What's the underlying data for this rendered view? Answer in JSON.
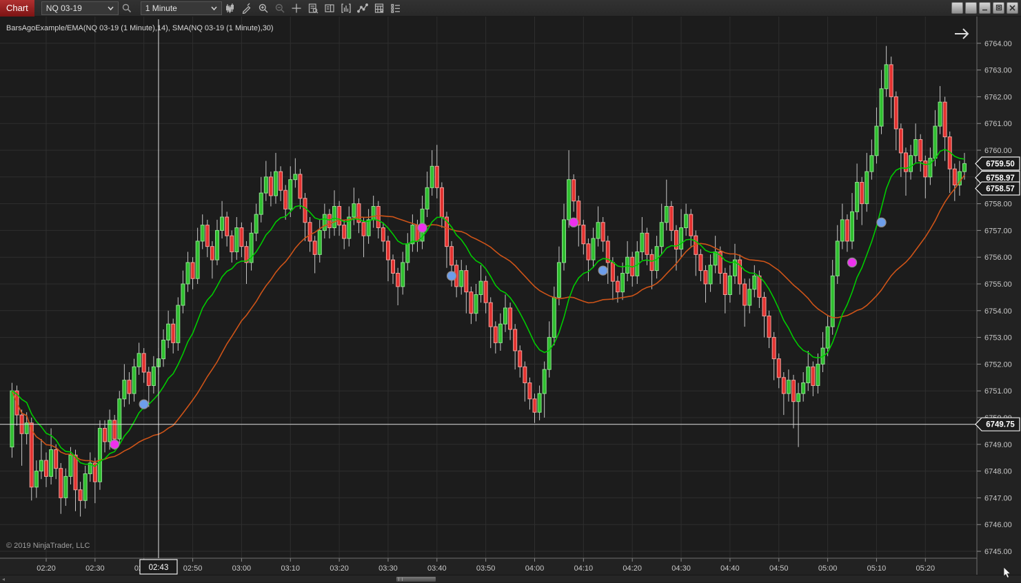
{
  "toolbar": {
    "tab_label": "Chart",
    "instrument": "NQ 03-19",
    "interval": "1 Minute",
    "icons": [
      "search-icon",
      "chart-style-icon",
      "drawing-tools-icon",
      "zoom-in-icon",
      "zoom-out-icon",
      "crosshair-icon",
      "data-box-icon",
      "chart-trader-icon",
      "indicators-icon",
      "line-tools-icon",
      "strategies-icon",
      "properties-icon"
    ]
  },
  "window": {
    "control_icons": [
      "instrument-link-icon",
      "interval-link-icon",
      "minimize-icon",
      "restore-icon",
      "close-icon"
    ]
  },
  "chart": {
    "title": "BarsAgoExample/EMA(NQ 03-19 (1 Minute),14), SMA(NQ 03-19 (1 Minute),30)",
    "copyright": "© 2019 NinjaTrader, LLC",
    "colors": {
      "plot_bg": "#1c1c1c",
      "axis_bg": "#222222",
      "grid": "#2e2e2e",
      "axis_line": "#6f6f6f",
      "up_fill": "#2fbf2f",
      "up_border": "#8fdf8f",
      "down_fill": "#e43230",
      "down_border": "#f2a19b",
      "wick": "#c8c8c8",
      "ema": "#00cc00",
      "sma": "#cf5418",
      "crosshair": "#e2e2e2",
      "tag_bg": "#1b1b1b",
      "tag_border": "#f0f0f0",
      "tick_text": "#c8c8c8"
    },
    "crosshair": {
      "time": "02:43",
      "time_label": "02:43",
      "price": 6749.75,
      "price_label": "6749.75"
    },
    "price_markers": [
      {
        "label": "6759.50",
        "price": 6759.5,
        "name": "last-price-marker"
      },
      {
        "label": "6758.97",
        "price": 6758.97,
        "name": "ema-value-marker"
      },
      {
        "label": "6758.57",
        "price": 6758.57,
        "name": "sma-value-marker"
      }
    ]
  },
  "chart_data": {
    "type": "candlestick",
    "title": "BarsAgoExample/EMA(NQ 03-19 (1 Minute),14), SMA(NQ 03-19 (1 Minute),30)",
    "instrument": "NQ 03-19",
    "interval": "1 Minute",
    "start_time": "02:13",
    "ylim": [
      6744.7,
      6765.0
    ],
    "y_ticks": [
      6745,
      6746,
      6747,
      6748,
      6749,
      6750,
      6751,
      6752,
      6753,
      6754,
      6755,
      6756,
      6757,
      6758,
      6759,
      6760,
      6761,
      6762,
      6763,
      6764
    ],
    "x_ticks": [
      "02:20",
      "02:30",
      "02:40",
      "02:50",
      "03:00",
      "03:10",
      "03:20",
      "03:30",
      "03:40",
      "03:50",
      "04:00",
      "04:10",
      "04:20",
      "04:30",
      "04:40",
      "04:50",
      "05:00",
      "05:10",
      "05:20"
    ],
    "indicators": [
      {
        "name": "EMA",
        "period": 14,
        "color": "#00cc00"
      },
      {
        "name": "SMA",
        "period": 30,
        "color": "#cf5418"
      }
    ],
    "dots": [
      {
        "time": "02:34",
        "price": 6749.0,
        "color": "#ee30ee"
      },
      {
        "time": "02:40",
        "price": 6750.5,
        "color": "#6d9eeb"
      },
      {
        "time": "03:37",
        "price": 6757.1,
        "color": "#ee30ee"
      },
      {
        "time": "03:43",
        "price": 6755.3,
        "color": "#6d9eeb"
      },
      {
        "time": "04:08",
        "price": 6757.3,
        "color": "#ee30ee"
      },
      {
        "time": "04:14",
        "price": 6755.5,
        "color": "#6d9eeb"
      },
      {
        "time": "05:05",
        "price": 6755.8,
        "color": "#ee30ee"
      },
      {
        "time": "05:11",
        "price": 6757.3,
        "color": "#6d9eeb"
      }
    ],
    "candles": [
      [
        6748.9,
        6751.3,
        6748.5,
        6751.0
      ],
      [
        6751.0,
        6751.2,
        6749.7,
        6750.1
      ],
      [
        6750.1,
        6750.3,
        6748.2,
        6749.4
      ],
      [
        6749.4,
        6750.2,
        6749.0,
        6749.8
      ],
      [
        6749.8,
        6750.0,
        6746.9,
        6747.4
      ],
      [
        6747.4,
        6748.4,
        6747.0,
        6748.0
      ],
      [
        6748.0,
        6749.2,
        6747.7,
        6748.4
      ],
      [
        6748.4,
        6748.7,
        6747.4,
        6747.8
      ],
      [
        6747.8,
        6749.6,
        6747.5,
        6748.8
      ],
      [
        6748.8,
        6749.0,
        6747.7,
        6748.1
      ],
      [
        6748.1,
        6748.3,
        6746.4,
        6747.0
      ],
      [
        6747.0,
        6748.1,
        6746.7,
        6747.8
      ],
      [
        6747.8,
        6748.9,
        6747.5,
        6748.6
      ],
      [
        6748.6,
        6748.8,
        6746.5,
        6747.3
      ],
      [
        6747.3,
        6747.6,
        6746.3,
        6746.9
      ],
      [
        6746.9,
        6748.2,
        6746.6,
        6747.9
      ],
      [
        6747.9,
        6748.7,
        6747.6,
        6748.3
      ],
      [
        6748.3,
        6748.5,
        6746.8,
        6747.6
      ],
      [
        6747.6,
        6749.9,
        6747.3,
        6749.6
      ],
      [
        6749.6,
        6749.9,
        6748.7,
        6749.1
      ],
      [
        6749.1,
        6750.3,
        6748.8,
        6749.9
      ],
      [
        6749.9,
        6750.1,
        6748.8,
        6749.2
      ],
      [
        6749.2,
        6751.0,
        6749.0,
        6750.7
      ],
      [
        6750.7,
        6752.0,
        6750.4,
        6751.4
      ],
      [
        6751.4,
        6751.7,
        6750.5,
        6750.9
      ],
      [
        6750.9,
        6752.2,
        6750.6,
        6751.9
      ],
      [
        6751.9,
        6752.8,
        6751.6,
        6752.4
      ],
      [
        6752.4,
        6752.6,
        6751.3,
        6751.7
      ],
      [
        6751.7,
        6751.9,
        6750.4,
        6751.2
      ],
      [
        6751.2,
        6752.3,
        6750.9,
        6751.9
      ],
      [
        6751.9,
        6752.6,
        6751.6,
        6752.2
      ],
      [
        6752.2,
        6753.3,
        6751.9,
        6752.9
      ],
      [
        6752.9,
        6754.0,
        6752.6,
        6753.5
      ],
      [
        6753.5,
        6753.7,
        6752.4,
        6752.8
      ],
      [
        6752.8,
        6754.5,
        6752.5,
        6754.2
      ],
      [
        6754.2,
        6755.5,
        6753.9,
        6755.0
      ],
      [
        6755.0,
        6756.2,
        6754.7,
        6755.8
      ],
      [
        6755.8,
        6756.0,
        6754.8,
        6755.2
      ],
      [
        6755.2,
        6757.1,
        6755.0,
        6756.6
      ],
      [
        6756.6,
        6757.6,
        6756.3,
        6757.2
      ],
      [
        6757.2,
        6757.4,
        6756.0,
        6756.4
      ],
      [
        6756.4,
        6756.6,
        6755.2,
        6755.9
      ],
      [
        6755.9,
        6757.4,
        6755.7,
        6757.0
      ],
      [
        6757.0,
        6758.1,
        6756.7,
        6757.5
      ],
      [
        6757.5,
        6757.7,
        6756.4,
        6756.8
      ],
      [
        6756.8,
        6757.0,
        6755.8,
        6756.2
      ],
      [
        6756.2,
        6757.5,
        6755.9,
        6757.1
      ],
      [
        6757.1,
        6757.3,
        6756.0,
        6756.4
      ],
      [
        6756.4,
        6756.6,
        6755.0,
        6755.8
      ],
      [
        6755.8,
        6757.3,
        6755.5,
        6756.9
      ],
      [
        6756.9,
        6758.0,
        6756.6,
        6757.6
      ],
      [
        6757.6,
        6759.0,
        6757.3,
        6758.4
      ],
      [
        6758.4,
        6759.6,
        6758.1,
        6759.0
      ],
      [
        6759.0,
        6759.2,
        6757.9,
        6758.3
      ],
      [
        6758.3,
        6759.9,
        6758.0,
        6759.2
      ],
      [
        6759.2,
        6759.4,
        6758.1,
        6758.5
      ],
      [
        6758.5,
        6758.7,
        6757.4,
        6757.8
      ],
      [
        6757.8,
        6759.4,
        6757.5,
        6758.9
      ],
      [
        6758.9,
        6759.7,
        6758.6,
        6759.1
      ],
      [
        6759.1,
        6759.3,
        6757.8,
        6758.2
      ],
      [
        6758.2,
        6758.4,
        6756.6,
        6757.3
      ],
      [
        6757.3,
        6757.5,
        6756.2,
        6756.6
      ],
      [
        6756.6,
        6756.8,
        6755.4,
        6756.1
      ],
      [
        6756.1,
        6757.4,
        6755.8,
        6757.0
      ],
      [
        6757.0,
        6758.0,
        6756.7,
        6757.6
      ],
      [
        6757.6,
        6757.8,
        6756.7,
        6757.1
      ],
      [
        6757.1,
        6758.5,
        6756.8,
        6757.9
      ],
      [
        6757.9,
        6758.1,
        6756.8,
        6757.2
      ],
      [
        6757.2,
        6757.4,
        6756.3,
        6756.7
      ],
      [
        6756.7,
        6757.9,
        6756.4,
        6757.5
      ],
      [
        6757.5,
        6758.6,
        6757.2,
        6758.0
      ],
      [
        6758.0,
        6758.2,
        6756.9,
        6757.3
      ],
      [
        6757.3,
        6757.5,
        6756.0,
        6756.8
      ],
      [
        6756.8,
        6757.8,
        6756.5,
        6757.4
      ],
      [
        6757.4,
        6758.3,
        6757.1,
        6757.9
      ],
      [
        6757.9,
        6758.1,
        6756.7,
        6757.1
      ],
      [
        6757.1,
        6757.3,
        6756.2,
        6756.6
      ],
      [
        6756.6,
        6756.8,
        6755.1,
        6755.9
      ],
      [
        6755.9,
        6756.1,
        6755.0,
        6755.4
      ],
      [
        6755.4,
        6755.6,
        6754.2,
        6754.9
      ],
      [
        6754.9,
        6756.2,
        6754.6,
        6755.8
      ],
      [
        6755.8,
        6756.9,
        6755.5,
        6756.5
      ],
      [
        6756.5,
        6757.6,
        6756.2,
        6757.2
      ],
      [
        6757.2,
        6757.4,
        6756.2,
        6756.6
      ],
      [
        6756.6,
        6758.3,
        6756.3,
        6757.8
      ],
      [
        6757.8,
        6759.2,
        6757.5,
        6758.6
      ],
      [
        6758.6,
        6760.0,
        6758.3,
        6759.4
      ],
      [
        6759.4,
        6760.2,
        6758.2,
        6758.6
      ],
      [
        6758.6,
        6758.8,
        6757.1,
        6757.5
      ],
      [
        6757.5,
        6757.7,
        6755.6,
        6756.4
      ],
      [
        6756.4,
        6756.6,
        6754.9,
        6755.7
      ],
      [
        6755.7,
        6755.9,
        6754.5,
        6754.9
      ],
      [
        6754.9,
        6755.9,
        6754.6,
        6755.5
      ],
      [
        6755.5,
        6755.7,
        6753.9,
        6754.7
      ],
      [
        6754.7,
        6754.9,
        6753.5,
        6753.9
      ],
      [
        6753.9,
        6755.0,
        6753.6,
        6754.6
      ],
      [
        6754.6,
        6755.7,
        6754.3,
        6755.1
      ],
      [
        6755.1,
        6755.3,
        6753.9,
        6754.3
      ],
      [
        6754.3,
        6754.5,
        6752.6,
        6753.4
      ],
      [
        6753.4,
        6753.6,
        6752.4,
        6752.8
      ],
      [
        6752.8,
        6753.9,
        6752.5,
        6753.5
      ],
      [
        6753.5,
        6754.6,
        6753.2,
        6754.1
      ],
      [
        6754.1,
        6754.3,
        6752.9,
        6753.3
      ],
      [
        6753.3,
        6753.5,
        6751.8,
        6752.5
      ],
      [
        6752.5,
        6752.7,
        6751.5,
        6751.9
      ],
      [
        6751.9,
        6752.1,
        6750.6,
        6751.3
      ],
      [
        6751.3,
        6751.5,
        6750.3,
        6750.7
      ],
      [
        6750.7,
        6750.9,
        6749.8,
        6750.2
      ],
      [
        6750.2,
        6751.2,
        6749.9,
        6750.9
      ],
      [
        6750.9,
        6752.1,
        6750.0,
        6751.8
      ],
      [
        6751.8,
        6753.6,
        6751.5,
        6753.0
      ],
      [
        6753.0,
        6754.9,
        6752.7,
        6754.5
      ],
      [
        6754.5,
        6756.4,
        6754.2,
        6755.8
      ],
      [
        6755.8,
        6758.0,
        6755.5,
        6757.4
      ],
      [
        6757.4,
        6760.0,
        6757.1,
        6758.9
      ],
      [
        6758.9,
        6759.1,
        6757.7,
        6758.1
      ],
      [
        6758.1,
        6758.3,
        6756.4,
        6757.2
      ],
      [
        6757.2,
        6757.4,
        6756.1,
        6756.5
      ],
      [
        6756.5,
        6756.7,
        6755.1,
        6755.9
      ],
      [
        6755.9,
        6757.1,
        6755.6,
        6756.7
      ],
      [
        6756.7,
        6757.9,
        6756.4,
        6757.3
      ],
      [
        6757.3,
        6757.5,
        6756.2,
        6756.6
      ],
      [
        6756.6,
        6756.8,
        6755.0,
        6755.8
      ],
      [
        6755.8,
        6756.0,
        6754.4,
        6755.1
      ],
      [
        6755.1,
        6755.3,
        6754.3,
        6754.7
      ],
      [
        6754.7,
        6755.8,
        6754.4,
        6755.4
      ],
      [
        6755.4,
        6756.6,
        6755.1,
        6756.0
      ],
      [
        6756.0,
        6756.2,
        6754.9,
        6755.3
      ],
      [
        6755.3,
        6756.6,
        6755.0,
        6756.2
      ],
      [
        6756.2,
        6757.5,
        6755.9,
        6756.9
      ],
      [
        6756.9,
        6757.1,
        6755.7,
        6756.1
      ],
      [
        6756.1,
        6756.3,
        6754.8,
        6755.5
      ],
      [
        6755.5,
        6756.8,
        6755.2,
        6756.4
      ],
      [
        6756.4,
        6758.0,
        6756.1,
        6757.3
      ],
      [
        6757.3,
        6758.9,
        6757.0,
        6757.9
      ],
      [
        6757.9,
        6758.1,
        6756.6,
        6757.0
      ],
      [
        6757.0,
        6757.2,
        6755.5,
        6756.3
      ],
      [
        6756.3,
        6757.8,
        6756.0,
        6757.1
      ],
      [
        6757.1,
        6758.0,
        6756.8,
        6757.6
      ],
      [
        6757.6,
        6757.8,
        6756.4,
        6756.8
      ],
      [
        6756.8,
        6757.0,
        6755.3,
        6756.1
      ],
      [
        6756.1,
        6756.3,
        6755.1,
        6755.5
      ],
      [
        6755.5,
        6755.7,
        6754.3,
        6755.0
      ],
      [
        6755.0,
        6756.1,
        6754.7,
        6755.7
      ],
      [
        6755.7,
        6756.8,
        6755.4,
        6756.2
      ],
      [
        6756.2,
        6756.4,
        6755.0,
        6755.4
      ],
      [
        6755.4,
        6755.6,
        6753.9,
        6754.6
      ],
      [
        6754.6,
        6755.7,
        6754.3,
        6755.3
      ],
      [
        6755.3,
        6756.5,
        6755.0,
        6755.9
      ],
      [
        6755.9,
        6756.1,
        6754.6,
        6755.0
      ],
      [
        6755.0,
        6755.2,
        6753.4,
        6754.2
      ],
      [
        6754.2,
        6755.2,
        6753.9,
        6754.8
      ],
      [
        6754.8,
        6755.7,
        6754.5,
        6755.3
      ],
      [
        6755.3,
        6755.5,
        6754.1,
        6754.5
      ],
      [
        6754.5,
        6754.7,
        6753.0,
        6753.8
      ],
      [
        6753.8,
        6754.0,
        6752.6,
        6753.0
      ],
      [
        6753.0,
        6753.2,
        6751.4,
        6752.2
      ],
      [
        6752.2,
        6752.4,
        6751.1,
        6751.5
      ],
      [
        6751.5,
        6751.7,
        6750.1,
        6750.9
      ],
      [
        6750.9,
        6751.8,
        6750.6,
        6751.4
      ],
      [
        6751.4,
        6751.6,
        6749.6,
        6750.6
      ],
      [
        6750.6,
        6751.3,
        6748.9,
        6750.9
      ],
      [
        6750.9,
        6751.7,
        6750.6,
        6751.3
      ],
      [
        6751.3,
        6752.5,
        6751.0,
        6751.9
      ],
      [
        6751.9,
        6752.1,
        6750.8,
        6751.2
      ],
      [
        6751.2,
        6752.4,
        6750.9,
        6752.0
      ],
      [
        6752.0,
        6753.2,
        6751.7,
        6752.6
      ],
      [
        6752.6,
        6753.8,
        6752.3,
        6753.4
      ],
      [
        6753.4,
        6755.9,
        6753.1,
        6755.3
      ],
      [
        6755.3,
        6757.2,
        6755.0,
        6756.6
      ],
      [
        6756.6,
        6758.0,
        6756.3,
        6757.4
      ],
      [
        6757.4,
        6757.6,
        6756.2,
        6756.6
      ],
      [
        6756.6,
        6758.4,
        6756.3,
        6757.7
      ],
      [
        6757.7,
        6759.5,
        6757.4,
        6758.8
      ],
      [
        6758.8,
        6759.0,
        6757.2,
        6758.0
      ],
      [
        6758.0,
        6759.9,
        6757.7,
        6759.2
      ],
      [
        6759.2,
        6760.4,
        6758.9,
        6759.8
      ],
      [
        6759.8,
        6761.6,
        6759.5,
        6760.9
      ],
      [
        6760.9,
        6763.0,
        6760.6,
        6762.3
      ],
      [
        6762.3,
        6763.9,
        6762.0,
        6763.2
      ],
      [
        6763.2,
        6763.5,
        6761.2,
        6762.0
      ],
      [
        6762.0,
        6762.2,
        6760.0,
        6760.8
      ],
      [
        6760.8,
        6761.0,
        6759.0,
        6759.9
      ],
      [
        6759.9,
        6760.1,
        6758.3,
        6759.2
      ],
      [
        6759.2,
        6760.2,
        6758.9,
        6759.8
      ],
      [
        6759.8,
        6761.0,
        6759.5,
        6760.4
      ],
      [
        6760.4,
        6760.6,
        6759.2,
        6759.6
      ],
      [
        6759.6,
        6759.8,
        6758.2,
        6759.0
      ],
      [
        6759.0,
        6760.1,
        6758.7,
        6759.7
      ],
      [
        6759.7,
        6761.5,
        6759.4,
        6760.9
      ],
      [
        6760.9,
        6762.4,
        6760.6,
        6761.8
      ],
      [
        6761.8,
        6762.0,
        6759.6,
        6760.5
      ],
      [
        6760.5,
        6760.7,
        6758.4,
        6759.3
      ],
      [
        6759.3,
        6759.5,
        6758.1,
        6758.7
      ],
      [
        6758.7,
        6759.6,
        6758.3,
        6759.2
      ],
      [
        6759.2,
        6759.9,
        6758.9,
        6759.5
      ]
    ]
  }
}
